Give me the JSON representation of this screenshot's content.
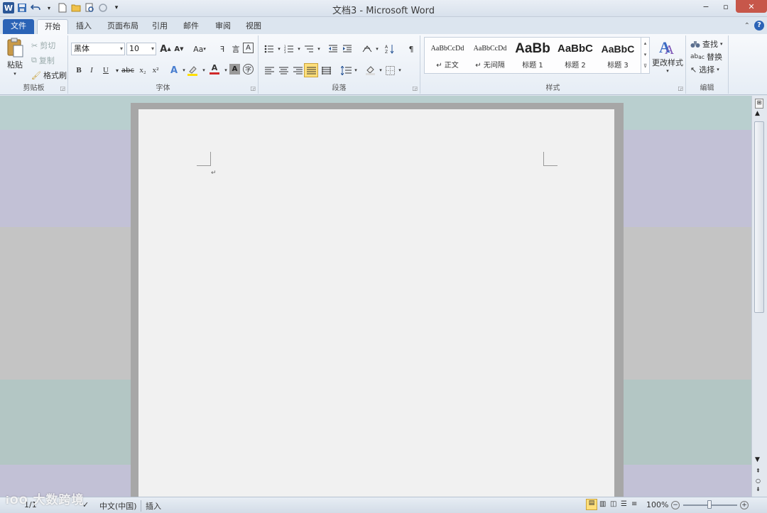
{
  "window": {
    "title": "文档3 - Microsoft Word",
    "minimize": "−",
    "maximize": "▫",
    "close": "✕"
  },
  "qat": {
    "app_icon": "W",
    "save": "💾",
    "undo": "↶",
    "dropdown": "▾"
  },
  "tabs": [
    {
      "label": "文件"
    },
    {
      "label": "开始"
    },
    {
      "label": "插入"
    },
    {
      "label": "页面布局"
    },
    {
      "label": "引用"
    },
    {
      "label": "邮件"
    },
    {
      "label": "审阅"
    },
    {
      "label": "视图"
    }
  ],
  "help_icon": "?",
  "clipboard": {
    "label": "剪贴板",
    "paste": "粘贴",
    "cut": "剪切",
    "copy": "复制",
    "format_painter": "格式刷"
  },
  "font": {
    "label": "字体",
    "name": "黑体",
    "size": "10",
    "grow": "A",
    "shrink": "A",
    "case": "Aa",
    "bold": "B",
    "italic": "I",
    "underline": "U",
    "strike": "abc",
    "subscript": "x₂",
    "superscript": "x²",
    "font_color": "A"
  },
  "paragraph": {
    "label": "段落"
  },
  "styles": {
    "label": "样式",
    "items": [
      {
        "sample": "AaBbCcDd",
        "name": "↵ 正文"
      },
      {
        "sample": "AaBbCcDd",
        "name": "↵ 无间隔"
      },
      {
        "sample": "AaBb",
        "name": "标题 1"
      },
      {
        "sample": "AaBbC",
        "name": "标题 2"
      },
      {
        "sample": "AaBbC",
        "name": "标题 3"
      }
    ],
    "change_styles": "更改样式"
  },
  "editing": {
    "label": "编辑",
    "find": "查找",
    "replace": "替换",
    "select": "选择"
  },
  "statusbar": {
    "page": "1/1",
    "language": "中文(中国)",
    "mode": "插入",
    "zoom": "100%"
  },
  "watermark": "大数跨境",
  "colors": {
    "file_tab": "#2b63b6",
    "highlight": "#ffdf7a",
    "font_red": "#d02a2a"
  }
}
